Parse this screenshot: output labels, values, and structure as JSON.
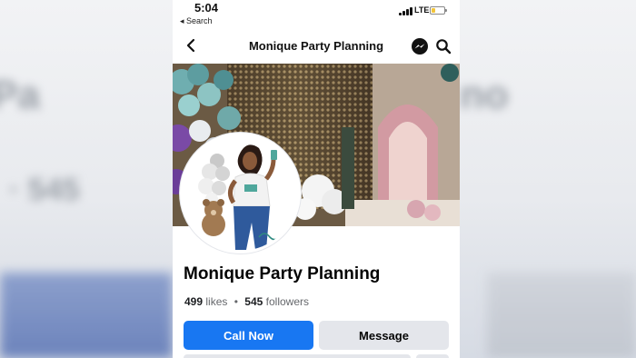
{
  "status_bar": {
    "time": "5:04",
    "back_label": "◂ Search",
    "network": "LTE"
  },
  "nav": {
    "title": "Monique Party Planning",
    "icons": [
      "back-chevron-icon",
      "messenger-icon",
      "search-icon"
    ]
  },
  "page": {
    "name": "Monique Party Planning",
    "likes_count": "499",
    "likes_label": "likes",
    "separator": "•",
    "followers_count": "545",
    "followers_label": "followers"
  },
  "actions": {
    "primary_label": "Call Now",
    "secondary_label": "Message"
  },
  "colors": {
    "accent": "#1877f2",
    "secondary_button": "#e4e6eb",
    "battery": "#f2c43a"
  }
}
